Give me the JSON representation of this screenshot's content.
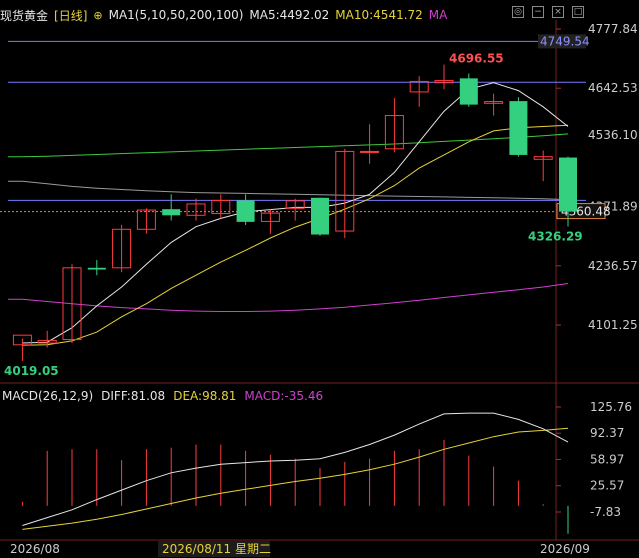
{
  "header": {
    "instrument": "现货黄金",
    "period": "[日线]",
    "ma_label": "MA1(5,10,50,200,100)",
    "ma5": "MA5:4492.02",
    "ma10": "MA10:4541.72",
    "ma": "MA"
  },
  "macd_header": {
    "title": "MACD(26,12,9)",
    "diff": "DIFF:81.08",
    "dea": "DEA:98.81",
    "macd": "MACD:-35.46"
  },
  "icons": [
    "target-icon",
    "minus-icon",
    "close-icon",
    "maximize-icon"
  ],
  "colors": {
    "up": "#ff3d3d",
    "down": "#35d07f",
    "ma5": "#e6e6e6",
    "ma10": "#e6d23a",
    "ma50": "#3ec83e",
    "ma100": "#d040d0",
    "ma200": "#9a9a9a",
    "hline": "#7a7aff"
  },
  "x_labels": {
    "start": "2026/08",
    "cursor": "2026/08/11 星期二",
    "end": "2026/09"
  },
  "chart_data": [
    {
      "type": "candlestick",
      "title": "现货黄金 [日线]",
      "y_ticks": [
        4777.84,
        4642.53,
        4536.1,
        4371.89,
        4236.57,
        4101.25
      ],
      "ylim": [
        4030,
        4810
      ],
      "current_price": 4360.48,
      "current_price_label": "4360.48",
      "reference_line": 4749.54,
      "reference_line_label": "4749.54",
      "upper_line": 4656,
      "lower_line": 4386,
      "annotations": {
        "high": "4696.55",
        "low": "4019.05",
        "last_low": "4326.29"
      },
      "candles": [
        {
          "o": 4056,
          "h": 4070,
          "l": 4019.05,
          "c": 4078
        },
        {
          "o": 4060,
          "h": 4088,
          "l": 4050,
          "c": 4066
        },
        {
          "o": 4068,
          "h": 4240,
          "l": 4060,
          "c": 4232
        },
        {
          "o": 4232,
          "h": 4250,
          "l": 4215,
          "c": 4228
        },
        {
          "o": 4232,
          "h": 4330,
          "l": 4222,
          "c": 4320
        },
        {
          "o": 4320,
          "h": 4368,
          "l": 4310,
          "c": 4364
        },
        {
          "o": 4366,
          "h": 4400,
          "l": 4340,
          "c": 4352
        },
        {
          "o": 4352,
          "h": 4390,
          "l": 4340,
          "c": 4378
        },
        {
          "o": 4356,
          "h": 4400,
          "l": 4345,
          "c": 4386
        },
        {
          "o": 4386,
          "h": 4400,
          "l": 4330,
          "c": 4337
        },
        {
          "o": 4338,
          "h": 4365,
          "l": 4310,
          "c": 4357
        },
        {
          "o": 4368,
          "h": 4390,
          "l": 4340,
          "c": 4385
        },
        {
          "o": 4392,
          "h": 4392,
          "l": 4305,
          "c": 4308
        },
        {
          "o": 4316,
          "h": 4504,
          "l": 4300,
          "c": 4498
        },
        {
          "o": 4497,
          "h": 4560,
          "l": 4470,
          "c": 4498
        },
        {
          "o": 4504,
          "h": 4620,
          "l": 4496,
          "c": 4580
        },
        {
          "o": 4634,
          "h": 4670,
          "l": 4600,
          "c": 4658
        },
        {
          "o": 4655,
          "h": 4696.55,
          "l": 4640,
          "c": 4660
        },
        {
          "o": 4665,
          "h": 4676,
          "l": 4600,
          "c": 4605
        },
        {
          "o": 4608,
          "h": 4630,
          "l": 4580,
          "c": 4612
        },
        {
          "o": 4613,
          "h": 4622,
          "l": 4486,
          "c": 4490
        },
        {
          "o": 4480,
          "h": 4500,
          "l": 4430,
          "c": 4486
        },
        {
          "o": 4484,
          "h": 4486,
          "l": 4326.29,
          "c": 4360.48
        }
      ],
      "ma5": [
        4060,
        4062,
        4095,
        4145,
        4188,
        4240,
        4290,
        4326,
        4345,
        4360,
        4365,
        4370,
        4370,
        4380,
        4400,
        4450,
        4520,
        4590,
        4640,
        4655,
        4637,
        4600,
        4555
      ],
      "ma10": [
        4055,
        4056,
        4065,
        4085,
        4120,
        4150,
        4185,
        4215,
        4245,
        4272,
        4300,
        4325,
        4345,
        4366,
        4390,
        4420,
        4460,
        4490,
        4520,
        4545,
        4552,
        4555,
        4558
      ],
      "ma50": [
        4486,
        4487,
        4489,
        4491,
        4493,
        4495,
        4497,
        4499,
        4501,
        4503,
        4505,
        4507,
        4509,
        4511,
        4513,
        4515,
        4518,
        4521,
        4524,
        4527,
        4530,
        4534,
        4538
      ],
      "ma100": [
        4160,
        4155,
        4150,
        4145,
        4141,
        4138,
        4135,
        4133,
        4132,
        4132,
        4133,
        4135,
        4138,
        4142,
        4147,
        4152,
        4158,
        4164,
        4170,
        4176,
        4182,
        4188,
        4196
      ],
      "ma200": [
        4430,
        4424,
        4418,
        4414,
        4411,
        4408,
        4406,
        4404,
        4403,
        4402,
        4401,
        4400,
        4399,
        4398,
        4397,
        4396,
        4395,
        4394,
        4393,
        4392,
        4391,
        4390,
        4388
      ]
    },
    {
      "type": "bar",
      "title": "MACD(26,12,9)",
      "y_ticks": [
        125.76,
        92.37,
        58.97,
        25.57,
        -7.83
      ],
      "ylim": [
        -30,
        135
      ],
      "series": [
        {
          "name": "DIFF",
          "values": [
            -25,
            -15,
            -5,
            8,
            20,
            32,
            42,
            48,
            53,
            55,
            57,
            58,
            60,
            68,
            78,
            90,
            104,
            117,
            118,
            118,
            110,
            98,
            81.08
          ]
        },
        {
          "name": "DEA",
          "values": [
            -30,
            -26,
            -22,
            -17,
            -11,
            -4,
            3,
            10,
            16,
            21,
            26,
            31,
            35,
            40,
            46,
            53,
            62,
            72,
            80,
            88,
            94,
            96,
            98.81
          ]
        },
        {
          "name": "MACD",
          "values": [
            5,
            70,
            72,
            72,
            58,
            72,
            74,
            78,
            78,
            70,
            65,
            60,
            48,
            56,
            60,
            70,
            72,
            84,
            64,
            50,
            32,
            2,
            -35.46
          ]
        }
      ]
    }
  ]
}
